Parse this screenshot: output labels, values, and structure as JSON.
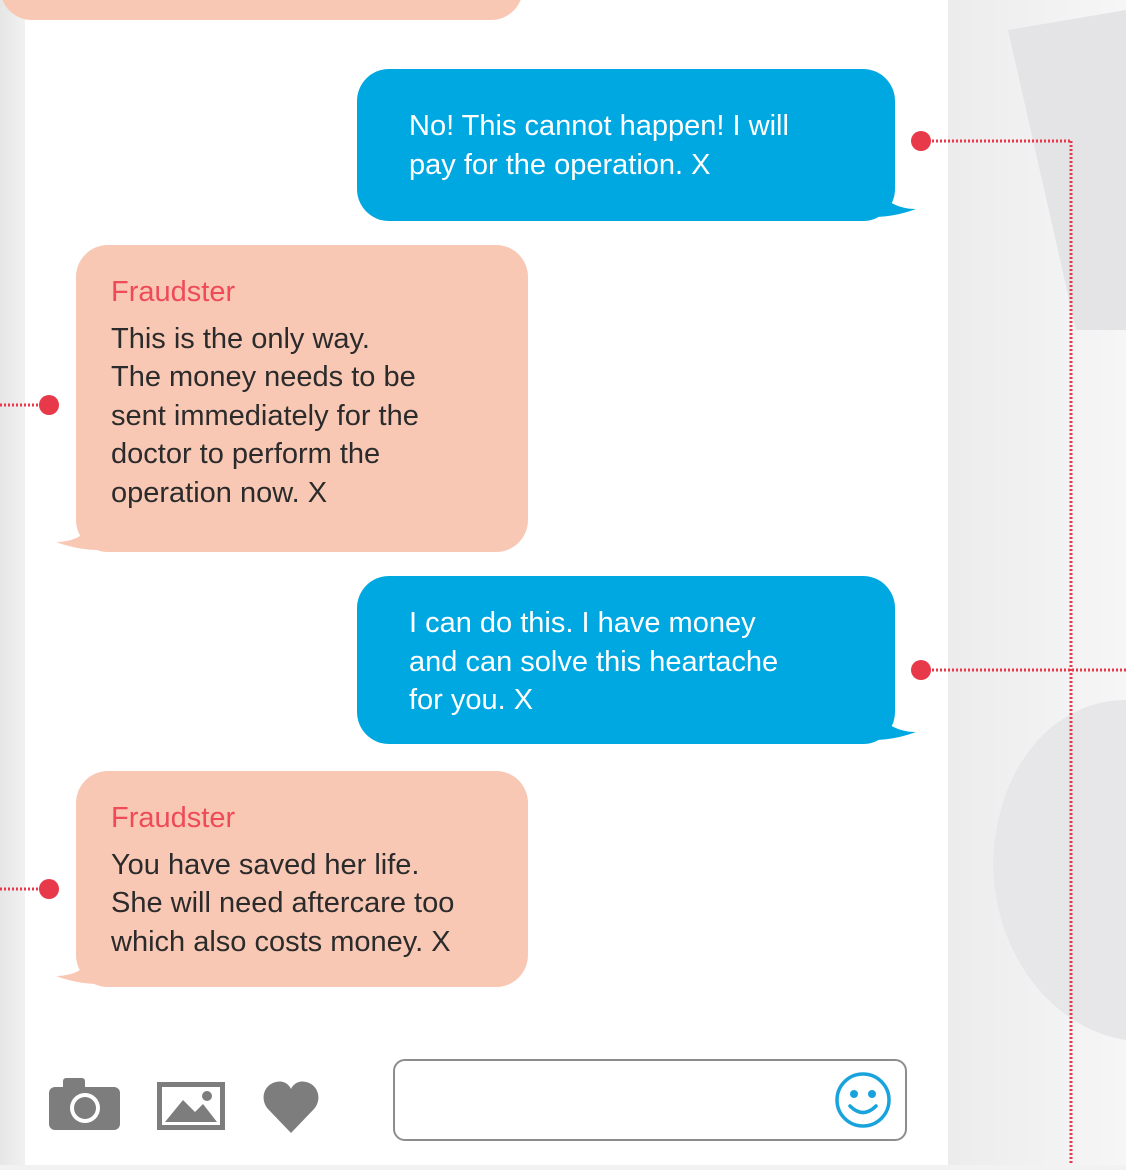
{
  "conversation": {
    "messages": [
      {
        "direction": "outgoing",
        "sender": "",
        "text": "No! This cannot happen! I will\npay for the operation. X"
      },
      {
        "direction": "incoming",
        "sender": "Fraudster",
        "text": "This is the only way.\nThe money needs to be\nsent immediately for the\ndoctor to perform the\noperation now. X"
      },
      {
        "direction": "outgoing",
        "sender": "",
        "text": "I can do this. I have money\nand can solve this heartache\nfor you. X"
      },
      {
        "direction": "incoming",
        "sender": "Fraudster",
        "text": "You have saved her life.\nShe will need aftercare too\nwhich also costs money. X"
      }
    ]
  },
  "composer": {
    "input_value": "",
    "input_placeholder": "",
    "icons": [
      "camera-icon",
      "image-icon",
      "heart-icon",
      "smiley-icon"
    ]
  },
  "colors": {
    "incoming_bubble": "#f9c8b5",
    "outgoing_bubble": "#00a8e2",
    "sender_name": "#ef4a58",
    "annotation_dot": "#e8394a",
    "icon_gray": "#7d7d7d",
    "emoji_blue": "#19a3dc"
  }
}
